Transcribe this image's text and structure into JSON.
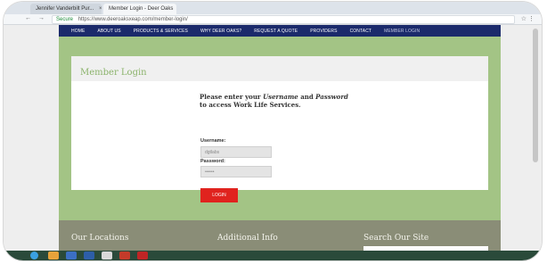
{
  "browser": {
    "tabs": [
      {
        "label": "Jennifer Vanderbilt Pur..."
      },
      {
        "label": "Member Login - Deer Oaks"
      }
    ],
    "tab_close": "×",
    "nav_glyphs": "← → C",
    "secure_label": "Secure",
    "url": "https://www.deeroaksxeap.com/member-login/",
    "addr_right": "☆ ⋮"
  },
  "nav": {
    "items": [
      "HOME",
      "ABOUT US",
      "PRODUCTS & SERVICES",
      "WHY DEER OAKS?",
      "REQUEST A QUOTE",
      "PROVIDERS",
      "CONTACT",
      "MEMBER LOGIN"
    ]
  },
  "login": {
    "title": "Member Login",
    "intro_line1": "Please enter your",
    "intro_user_word": "Username",
    "intro_and": "and",
    "intro_pass_word": "Password",
    "intro_line2": "to access Work Life Services.",
    "username_label": "Username:",
    "username_value": "dgtlabs",
    "password_label": "Password:",
    "password_value": "••••••",
    "button": "LOGIN"
  },
  "footer": {
    "col1": "Our Locations",
    "col2": "Additional Info",
    "col3": "Search Our Site"
  },
  "colors": {
    "nav": "#1b2a6b",
    "green": "#a3c485",
    "title_green": "#8bb36b",
    "button_red": "#e0231e",
    "footer": "#8a8d77"
  }
}
